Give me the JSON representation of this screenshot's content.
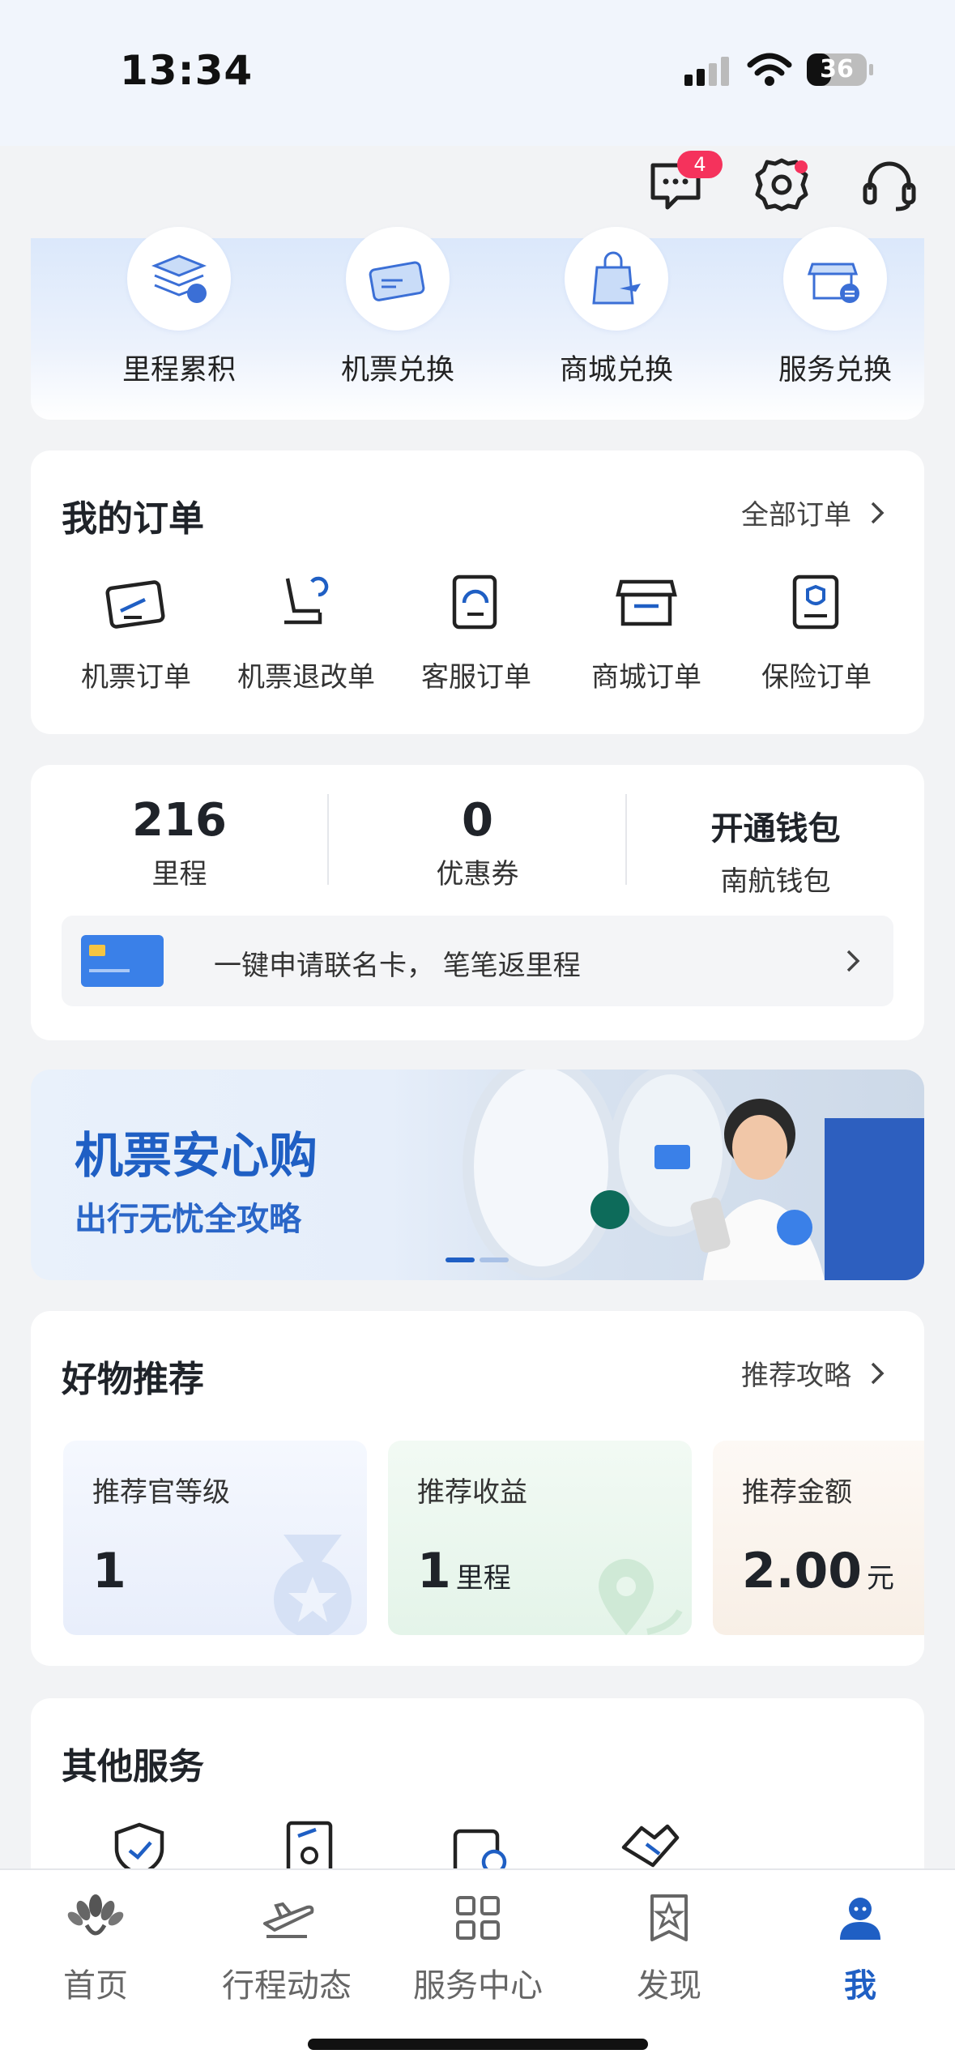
{
  "status_bar": {
    "time": "13:34",
    "battery": "36"
  },
  "header": {
    "message_badge": "4"
  },
  "exchange": [
    {
      "label": "里程累积",
      "icon": "mileage-stack-icon"
    },
    {
      "label": "机票兑换",
      "icon": "ticket-icon"
    },
    {
      "label": "商城兑换",
      "icon": "shopping-bag-plane-icon"
    },
    {
      "label": "服务兑换",
      "icon": "service-store-icon"
    }
  ],
  "orders": {
    "title": "我的订单",
    "all_label": "全部订单",
    "items": [
      {
        "label": "机票订单",
        "icon": "flight-ticket-icon"
      },
      {
        "label": "机票退改单",
        "icon": "seat-refund-icon"
      },
      {
        "label": "客服订单",
        "icon": "customer-service-doc-icon"
      },
      {
        "label": "商城订单",
        "icon": "store-icon"
      },
      {
        "label": "保险订单",
        "icon": "insurance-doc-icon"
      }
    ]
  },
  "wallet": {
    "stats": [
      {
        "value": "216",
        "label": "里程"
      },
      {
        "value": "0",
        "label": "优惠券"
      },
      {
        "value": "开通钱包",
        "label": "南航钱包"
      }
    ],
    "promo_text": "一键申请联名卡， 笔笔返里程"
  },
  "banner": {
    "title": "机票安心购",
    "subtitle": "出行无忧全攻略"
  },
  "recommend": {
    "title": "好物推荐",
    "link": "推荐攻略",
    "boxes": [
      {
        "label": "推荐官等级",
        "value": "1",
        "unit": ""
      },
      {
        "label": "推荐收益",
        "value": "1",
        "unit": "里程"
      },
      {
        "label": "推荐金额",
        "value": "2.00",
        "unit": "元"
      }
    ]
  },
  "other_services": {
    "title": "其他服务"
  },
  "tabbar": [
    {
      "label": "首页",
      "icon": "home-logo-icon"
    },
    {
      "label": "行程动态",
      "icon": "plane-icon"
    },
    {
      "label": "服务中心",
      "icon": "grid-icon"
    },
    {
      "label": "发现",
      "icon": "star-bookmark-icon"
    },
    {
      "label": "我",
      "icon": "user-icon"
    }
  ],
  "colors": {
    "accent": "#1f5fc4",
    "badge": "#f5325c",
    "background": "#f2f3f5"
  }
}
